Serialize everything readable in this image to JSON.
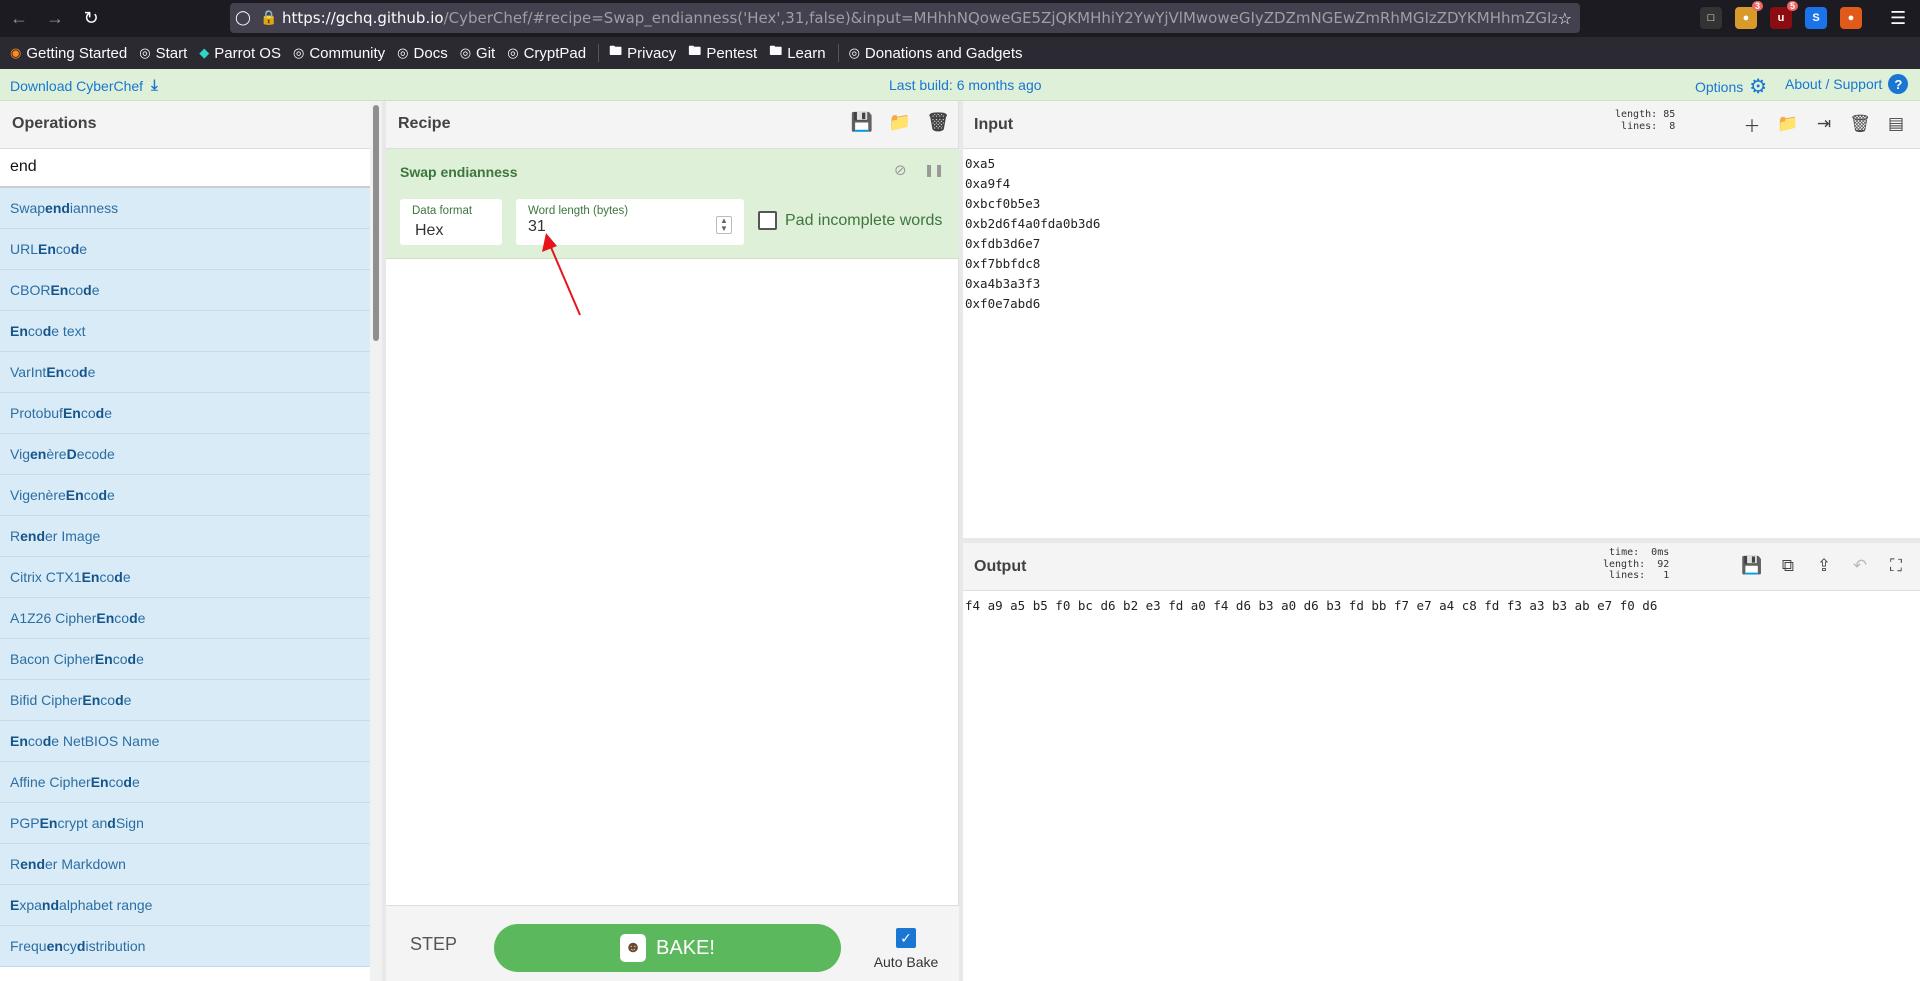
{
  "browser": {
    "url_host": "https://gchq.github.io",
    "url_path": "/CyberChef/#recipe=Swap_endianness('Hex',31,false)&input=MHhhNQoweGE5ZjQKMHhiY2YwYjVlMwoweGIyZDZmNGEwZmRhMGIzZDYKMHhmZGIzZDZl",
    "bookmarks": [
      "Getting Started",
      "Start",
      "Parrot OS",
      "Community",
      "Docs",
      "Git",
      "CryptPad",
      "Privacy",
      "Pentest",
      "Learn",
      "Donations and Gadgets"
    ],
    "ext_badges": [
      "3",
      "5"
    ]
  },
  "banner": {
    "download": "Download CyberChef",
    "build": "Last build: 6 months ago",
    "options": "Options",
    "about": "About / Support"
  },
  "operations": {
    "title": "Operations",
    "search": "end",
    "items": [
      {
        "pre": "Swap ",
        "hl": "end",
        "post": "ianness"
      },
      {
        "pre": "URL ",
        "hl": "En",
        "mid": "co",
        "hl2": "d",
        "post": "e"
      },
      {
        "pre": "CBOR ",
        "hl": "En",
        "mid": "co",
        "hl2": "d",
        "post": "e"
      },
      {
        "pre": "",
        "hl": "En",
        "mid": "co",
        "hl2": "d",
        "post": "e text"
      },
      {
        "pre": "VarInt ",
        "hl": "En",
        "mid": "co",
        "hl2": "d",
        "post": "e"
      },
      {
        "pre": "Protobuf ",
        "hl": "En",
        "mid": "co",
        "hl2": "d",
        "post": "e"
      },
      {
        "pre": "Vig",
        "hl": "en",
        "mid": "ère ",
        "hl2": "D",
        "post": "ecode"
      },
      {
        "pre": "Vigenère ",
        "hl": "En",
        "mid": "co",
        "hl2": "d",
        "post": "e"
      },
      {
        "pre": "R",
        "hl": "end",
        "post": "er Image"
      },
      {
        "pre": "Citrix CTX1 ",
        "hl": "En",
        "mid": "co",
        "hl2": "d",
        "post": "e"
      },
      {
        "pre": "A1Z26 Cipher ",
        "hl": "En",
        "mid": "co",
        "hl2": "d",
        "post": "e"
      },
      {
        "pre": "Bacon Cipher ",
        "hl": "En",
        "mid": "co",
        "hl2": "d",
        "post": "e"
      },
      {
        "pre": "Bifid Cipher ",
        "hl": "En",
        "mid": "co",
        "hl2": "d",
        "post": "e"
      },
      {
        "pre": "",
        "hl": "En",
        "mid": "co",
        "hl2": "d",
        "post": "e NetBIOS Name"
      },
      {
        "pre": "Affine Cipher ",
        "hl": "En",
        "mid": "co",
        "hl2": "d",
        "post": "e"
      },
      {
        "pre": "PGP ",
        "hl": "En",
        "mid": "crypt an",
        "hl2": "d",
        "post": " Sign"
      },
      {
        "pre": "R",
        "hl": "end",
        "post": "er Markdown"
      },
      {
        "pre": "",
        "hl": "E",
        "mid": "xpa",
        "hl2": "nd",
        "post": " alphabet range"
      },
      {
        "pre": "Frequ",
        "hl": "en",
        "mid": "cy ",
        "hl2": "d",
        "post": "istribution"
      }
    ]
  },
  "recipe": {
    "title": "Recipe",
    "op_name": "Swap endianness",
    "data_format_label": "Data format",
    "data_format_value": "Hex",
    "word_length_label": "Word length (bytes)",
    "word_length_value": "31",
    "pad_label": "Pad incomplete words",
    "step": "STEP",
    "bake": "BAKE!",
    "auto_bake": "Auto Bake"
  },
  "input": {
    "title": "Input",
    "length_label": "length:",
    "length": "85",
    "lines_label": "lines:",
    "lines": "8",
    "text": "0xa5\n0xa9f4\n0xbcf0b5e3\n0xb2d6f4a0fda0b3d6\n0xfdb3d6e7\n0xf7bbfdc8\n0xa4b3a3f3\n0xf0e7abd6"
  },
  "output": {
    "title": "Output",
    "time_label": "time:",
    "time": "0ms",
    "length_label": "length:",
    "length": "92",
    "lines_label": "lines:",
    "lines": "1",
    "text": "f4 a9 a5 b5 f0 bc d6 b2 e3 fd a0 f4 d6 b3 a0 d6 b3 fd bb f7 e7 a4 c8 fd f3 a3 b3 ab e7 f0 d6"
  },
  "colors": {
    "accent": "#1976d2",
    "recipe_bg": "#dff0d8",
    "op_list_bg": "#d8ebf7",
    "bake_green": "#5cb85c",
    "annotation_arrow": "#e8141c"
  }
}
